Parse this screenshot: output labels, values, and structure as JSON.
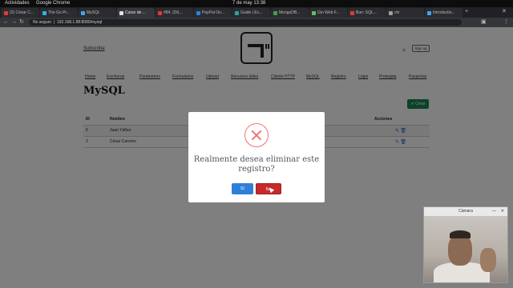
{
  "os": {
    "activities": "Actividades",
    "app": "Google Chrome",
    "clock": "7 de may 13:38"
  },
  "tabs": [
    {
      "label": "(2) César C...",
      "color": "#e53935"
    },
    {
      "label": "The Go Pr...",
      "color": "#29b6f6"
    },
    {
      "label": "MySQL",
      "color": "#42a5f5"
    },
    {
      "label": "Curso de ...",
      "color": "#e0e0e0"
    },
    {
      "label": "#84. (Dt)...",
      "color": "#e53935"
    },
    {
      "label": "PayPal On...",
      "color": "#1e88e5"
    },
    {
      "label": "Guide | Ec...",
      "color": "#26a69a"
    },
    {
      "label": "MongoDB...",
      "color": "#43a047"
    },
    {
      "label": "Gin Web F...",
      "color": "#66bb6a"
    },
    {
      "label": "Bun: SQL...",
      "color": "#e53935"
    },
    {
      "label": "chi",
      "color": "#9e9e9e"
    },
    {
      "label": "Introductio...",
      "color": "#42a5f5"
    }
  ],
  "address": {
    "security": "No seguro",
    "url": "192.168.1.88:8080/mysql"
  },
  "header": {
    "subscribe": "Subscribe",
    "signup": "Sign up"
  },
  "menu": [
    "Home",
    "Escrituras",
    "Parámetros",
    "Formularios",
    "Upload",
    "Recursos útiles",
    "Cliente HTTP",
    "MySQL",
    "Registro",
    "Login",
    "Protegida",
    "Pasarelas"
  ],
  "page_title": "MySQL",
  "crear_label": "Crear",
  "table": {
    "headers": [
      "ID",
      "Nombre",
      "Acciones"
    ],
    "rows": [
      {
        "id": "5",
        "name": "Juan Yáñez"
      },
      {
        "id": "2",
        "name": "César Cancino"
      }
    ]
  },
  "modal": {
    "title": "Realmente desea eliminar este registro?",
    "yes": "Sí",
    "no": "No"
  },
  "camera": {
    "title": "Cámara"
  }
}
